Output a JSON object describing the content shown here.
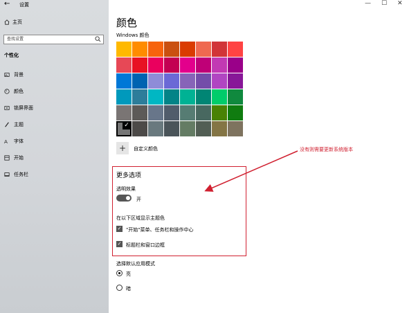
{
  "titlebar": {
    "back_icon": "back-arrow-icon",
    "title": "设置"
  },
  "sidebar": {
    "home_label": "主页",
    "search_placeholder": "查找设置",
    "section_title": "个性化",
    "items": [
      {
        "label": "背景",
        "icon": "picture-icon"
      },
      {
        "label": "颜色",
        "icon": "palette-icon"
      },
      {
        "label": "锁屏界面",
        "icon": "lock-screen-icon"
      },
      {
        "label": "主题",
        "icon": "theme-brush-icon"
      },
      {
        "label": "字体",
        "icon": "font-icon"
      },
      {
        "label": "开始",
        "icon": "start-icon"
      },
      {
        "label": "任务栏",
        "icon": "taskbar-icon"
      }
    ]
  },
  "window_controls": {
    "minimize": "—",
    "maximize": "☐",
    "close": "✕"
  },
  "main": {
    "title": "颜色",
    "windows_colors_label": "Windows 颜色",
    "swatches": [
      "#FFB900",
      "#FF8C00",
      "#F7630C",
      "#CA5010",
      "#DA3B01",
      "#EF6950",
      "#D13438",
      "#FF4343",
      "#E74856",
      "#E81123",
      "#EA005E",
      "#C30052",
      "#E3008C",
      "#BF0077",
      "#C239B3",
      "#9A0089",
      "#0078D7",
      "#0063B1",
      "#8E8CD8",
      "#6B69D6",
      "#8764B8",
      "#744DA9",
      "#B146C2",
      "#881798",
      "#0099BC",
      "#2D7D9A",
      "#00B7C3",
      "#038387",
      "#00B294",
      "#018574",
      "#00CC6A",
      "#10893E",
      "#7A7574",
      "#5D5A58",
      "#68768A",
      "#515C6B",
      "#567C73",
      "#486860",
      "#498205",
      "#107C10",
      "#767676",
      "#4C4A48",
      "#69797E",
      "#4A5459",
      "#647C64",
      "#525E54",
      "#847545",
      "#7E735F"
    ],
    "selected_swatch_index": 40,
    "custom_color_label": "自定义颜色",
    "more_options_title": "更多选项",
    "transparency_label": "透明效果",
    "transparency_state": "开",
    "accent_surfaces_label": "在以下区域显示主题色",
    "checkbox_start": "\"开始\"菜单、任务栏和操作中心",
    "checkbox_titlebar": "标题栏和窗口边框",
    "app_mode_label": "选择默认应用模式",
    "mode_light": "亮",
    "mode_dark": "暗"
  },
  "annotation": {
    "text": "没有则需要更新系统版本",
    "color": "#D02030"
  }
}
